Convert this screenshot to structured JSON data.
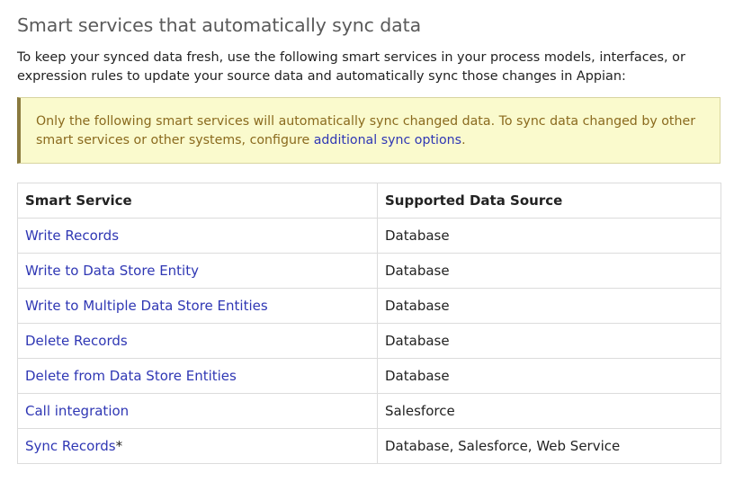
{
  "heading": "Smart services that automatically sync data",
  "intro": "To keep your synced data fresh, use the following smart services in your process models, interfaces, or expression rules to update your source data and automatically sync those changes in Appian:",
  "notice": {
    "text_before": "Only the following smart services will automatically sync changed data. To sync data changed by other smart services or other systems, configure ",
    "link": "additional sync options",
    "text_after": "."
  },
  "table": {
    "headers": [
      "Smart Service",
      "Supported Data Source"
    ],
    "rows": [
      {
        "service": "Write Records",
        "suffix": "",
        "source": "Database"
      },
      {
        "service": "Write to Data Store Entity",
        "suffix": "",
        "source": "Database"
      },
      {
        "service": "Write to Multiple Data Store Entities",
        "suffix": "",
        "source": "Database"
      },
      {
        "service": "Delete Records",
        "suffix": "",
        "source": "Database"
      },
      {
        "service": "Delete from Data Store Entities",
        "suffix": "",
        "source": "Database"
      },
      {
        "service": "Call integration",
        "suffix": "",
        "source": "Salesforce"
      },
      {
        "service": "Sync Records",
        "suffix": "*",
        "source": "Database, Salesforce, Web Service"
      }
    ]
  }
}
